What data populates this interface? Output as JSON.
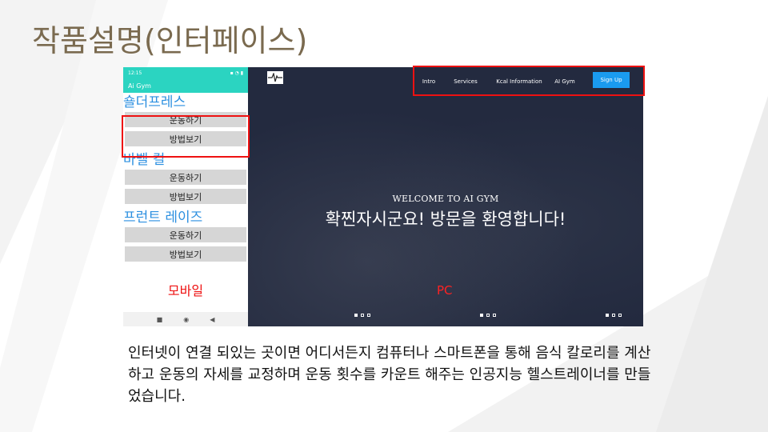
{
  "slide": {
    "title": "작품설명(인터페이스)"
  },
  "mobile": {
    "status_time": "12:15",
    "status_icons": "▪ ◔ ▮",
    "app_title": "Ai Gym",
    "sections": [
      {
        "heading": "숄더프레스",
        "buttons": [
          "운동하기",
          "방법보기"
        ]
      },
      {
        "heading": "바벨 컬",
        "buttons": [
          "운동하기",
          "방법보기"
        ]
      },
      {
        "heading": "프런트 레이즈",
        "buttons": [
          "운동하기",
          "방법보기"
        ]
      }
    ],
    "label": "모바일",
    "navbar": {
      "square": "■",
      "home": "◉",
      "back": "◀"
    }
  },
  "pc": {
    "nav": [
      "Intro",
      "Services",
      "Kcal Information",
      "AI Gym"
    ],
    "signup": "Sign Up",
    "welcome": "WELCOME TO AI GYM",
    "hero": "확찐자시군요! 방문을 환영합니다!",
    "label": "PC"
  },
  "description": "인터넷이 연결 되있는 곳이면 어디서든지 컴퓨터나 스마트폰을 통해 음식 칼로리를 계산하고 운동의 자세를 교정하며 운동 횟수를 카운트 해주는 인공지능 헬스트레이너를 만들었습니다.",
  "colors": {
    "accent": "#2bd4c1",
    "heading_blue": "#2b8fe0",
    "highlight_red": "#e11111",
    "pc_bg": "#232a3f",
    "signup_blue": "#1a9bf0"
  },
  "icons": [
    "pulse-logo-icon",
    "square-nav-icon",
    "home-nav-icon",
    "back-nav-icon"
  ]
}
